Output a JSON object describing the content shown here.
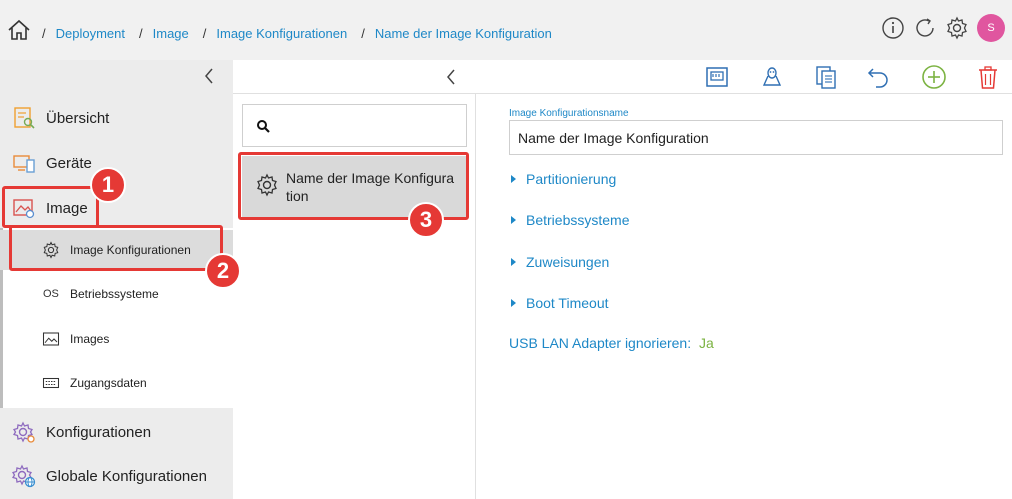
{
  "breadcrumb": {
    "items": [
      "Deployment",
      "Image",
      "Image Konfigurationen",
      "Name der Image Konfiguration"
    ],
    "separator": "/"
  },
  "header": {
    "user_initial": "S",
    "icons": [
      "info-icon",
      "refresh-icon",
      "settings-icon"
    ]
  },
  "sidebar": {
    "items": [
      {
        "label": "Übersicht",
        "icon": "overview-icon"
      },
      {
        "label": "Geräte",
        "icon": "devices-icon"
      },
      {
        "label": "Image",
        "icon": "image-icon"
      },
      {
        "label": "Konfigurationen",
        "icon": "configurations-icon"
      },
      {
        "label": "Globale Konfigurationen",
        "icon": "global-configurations-icon"
      }
    ],
    "sub_items": [
      {
        "label": "Image Konfigurationen",
        "icon": "gear-icon",
        "active": true
      },
      {
        "label": "Betriebssysteme",
        "prefix": "OS"
      },
      {
        "label": "Images",
        "icon": "image-icon"
      },
      {
        "label": "Zugangsdaten",
        "icon": "keyboard-icon"
      }
    ]
  },
  "list": {
    "search_placeholder": "",
    "items": [
      {
        "label": "Name der Image Konfiguration"
      }
    ]
  },
  "toolbar": {
    "icons": [
      "network-icon",
      "linux-icon",
      "copy-icon",
      "undo-icon",
      "add-icon",
      "delete-icon"
    ]
  },
  "detail": {
    "name_label": "Image Konfigurationsname",
    "name_value": "Name der Image Konfiguration",
    "sections": [
      "Partitionierung",
      "Betriebssysteme",
      "Zuweisungen",
      "Boot Timeout"
    ],
    "usb_label": "USB LAN Adapter ignorieren:",
    "usb_value": "Ja"
  },
  "annotations": {
    "badges": [
      "1",
      "2",
      "3"
    ]
  },
  "colors": {
    "accent": "#1e88c7",
    "highlight": "#e53935",
    "success": "#7cb342",
    "avatar": "#e0569f"
  }
}
